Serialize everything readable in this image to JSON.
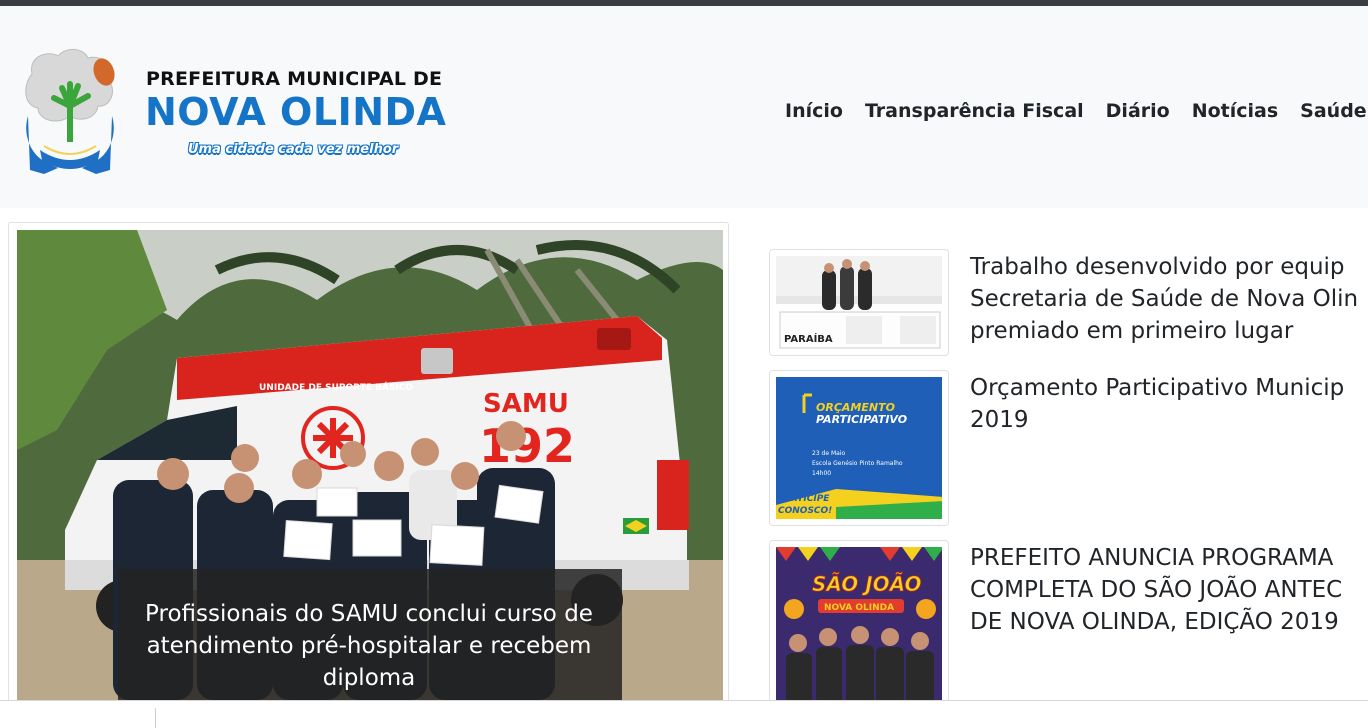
{
  "brand": {
    "top_line": "PREFEITURA MUNICIPAL DE",
    "name": "NOVA OLINDA",
    "slogan": "Uma cidade cada vez melhor",
    "emblem_icon": "municipal-coat-of-arms"
  },
  "nav": {
    "items": [
      {
        "label": "Início"
      },
      {
        "label": "Transparência Fiscal"
      },
      {
        "label": "Diário"
      },
      {
        "label": "Notícias"
      },
      {
        "label": "Saúde",
        "dropdown": true
      }
    ]
  },
  "featured": {
    "caption": "Profissionais do SAMU conclui curso de atendimento pré-hospitalar e recebem diploma",
    "image_texts": {
      "vehicle_label": "UNIDADE DE SUPORTE BÁSICO",
      "samu": "SAMU",
      "number": "192"
    }
  },
  "news": [
    {
      "title_lines": [
        "Trabalho desenvolvido por equip",
        "Secretaria de Saúde de Nova Olin",
        "premiado em primeiro lugar"
      ],
      "thumb_text": "PARAÍBA"
    },
    {
      "title_lines": [
        "Orçamento Participativo Municip",
        "2019"
      ],
      "thumb_text": {
        "title1": "ORÇAMENTO",
        "title2": "PARTICIPATIVO",
        "line1": "23 de Maio",
        "line2": "Escola Genésio Pinto Ramalho",
        "line3": "14h00",
        "cta1": "PARTICIPE",
        "cta2": "CONOSCO!"
      }
    },
    {
      "title_lines": [
        "PREFEITO ANUNCIA PROGRAMA",
        "COMPLETA DO SÃO JOÃO ANTEC",
        "DE NOVA OLINDA, EDIÇÃO 2019"
      ],
      "thumb_text": {
        "title1": "SÃO JOÃO",
        "title2": "NOVA OLINDA"
      }
    }
  ],
  "colors": {
    "brand_blue": "#1474c7",
    "header_bg": "#f8f9fa",
    "text": "#212529",
    "samu_red": "#e2251f"
  }
}
